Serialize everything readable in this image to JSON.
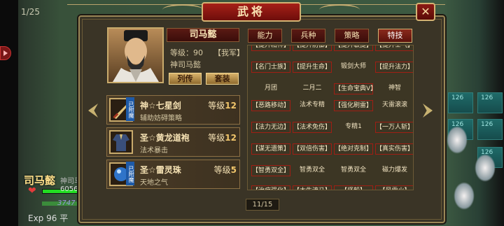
{
  "screen": {
    "page_indicator": "1/25"
  },
  "window": {
    "title": "武将",
    "close_label": "✕"
  },
  "general": {
    "name": "司马懿",
    "level_label": "等级：90",
    "faction": "【我军】",
    "skill_name": "神司马懿",
    "buttons": {
      "biography": "列传",
      "outfit": "套装"
    }
  },
  "equipment": [
    {
      "tag": "已附魔",
      "name": "神☆七星剑",
      "level_label": "等级",
      "level": "12",
      "desc": "辅助妨碍策略"
    },
    {
      "tag": "",
      "name": "圣☆黄龙道袍",
      "level_label": "等级",
      "level": "12",
      "desc": "法术暴击"
    },
    {
      "tag": "已附魔",
      "name": "圣☆雷灵珠",
      "level_label": "等级",
      "level": "5",
      "desc": "天地之气"
    }
  ],
  "tabs": [
    {
      "label": "能力",
      "active": false
    },
    {
      "label": "兵种",
      "active": false
    },
    {
      "label": "策略",
      "active": false
    },
    {
      "label": "特技",
      "active": true
    }
  ],
  "traits": [
    [
      "【提升精神】",
      "【提升防御】",
      "【提升敏捷】",
      "【提升士气】"
    ],
    [
      "【名门士族】",
      "【提升生命】",
      "锻剑大师",
      "【提升法力】"
    ],
    [
      "月团",
      "二月二",
      "【生命宝典Ⅴ】",
      "神智"
    ],
    [
      "【恶路移动】",
      "法术专精",
      "【强化刷雷】",
      "天雷滚滚"
    ],
    [
      "【法力无边】",
      "【法术免伤】",
      "专精1",
      "【一万人斩】"
    ],
    [
      "【谋无遗策】",
      "【双倍伤害】",
      "【绝对克制】",
      "【真实伤害】"
    ],
    [
      "【智勇双全】",
      "智勇双全",
      "智勇双全",
      "磁力爆发"
    ],
    [
      "【治疗强化】",
      "【木牛流马】",
      "【坚毅】",
      "【风雷火】"
    ]
  ],
  "trait_boxed": [
    [
      true,
      true,
      true,
      true
    ],
    [
      true,
      true,
      false,
      true
    ],
    [
      false,
      false,
      true,
      false
    ],
    [
      true,
      false,
      true,
      false
    ],
    [
      true,
      true,
      false,
      true
    ],
    [
      true,
      true,
      true,
      true
    ],
    [
      true,
      false,
      false,
      false
    ],
    [
      true,
      true,
      true,
      true
    ]
  ],
  "pager": "11/15",
  "hud": {
    "hero_name": "司马懿",
    "hero_subname": "神司马",
    "hp_text": "6056",
    "mp_text": "3747",
    "exp_text": "Exp  96  平"
  },
  "tiles": [
    "126",
    "126",
    "126",
    "126",
    "126"
  ]
}
